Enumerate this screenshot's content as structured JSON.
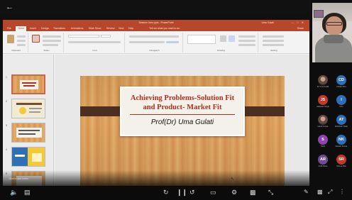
{
  "player": {
    "back_icon": "back-arrow-icon",
    "bottom_icons": [
      "speaker-icon",
      "captions-icon",
      "previous-icon",
      "pause-icon",
      "next-icon",
      "present-icon",
      "settings-icon",
      "fullscreen-icon",
      "pen-icon",
      "expand-icon"
    ]
  },
  "powerpoint": {
    "window_title": "Session Intro.pptx - PowerPoint",
    "user_name": "Uma Gulati",
    "ribbon_tabs": [
      "File",
      "Home",
      "Insert",
      "Design",
      "Transitions",
      "Animations",
      "Slide Show",
      "Review",
      "View",
      "Help"
    ],
    "active_tab": "Home",
    "search_hint": "Tell me what you want to do",
    "share_label": "Share",
    "ribbon_groups": [
      "Clipboard",
      "Slides",
      "Font",
      "Paragraph",
      "Drawing",
      "Editing"
    ],
    "slide_numbers": [
      "1",
      "2",
      "3",
      "4",
      "5"
    ],
    "status_text": "Click to add notes",
    "accent": "#b7472a"
  },
  "slide": {
    "title": "Achieving Problems-Solution Fit and Product- Market Fit",
    "author": "Prof(Dr) Uma Gulati",
    "title_color": "#b12f1d"
  },
  "participants": [
    {
      "initials": "",
      "name": "Dr Uma Gulati",
      "color": "",
      "photo": true
    },
    {
      "initials": "CD",
      "name": "Chetan Dev",
      "color": "#2f6fb5",
      "photo": false
    },
    {
      "initials": "JS",
      "name": "Jaskaran Singh",
      "color": "#c0392b",
      "photo": false
    },
    {
      "initials": "I",
      "name": "Ishu",
      "color": "#2f6fb5",
      "photo": false
    },
    {
      "initials": "",
      "name": "Harsh Gupta",
      "color": "",
      "photo": true
    },
    {
      "initials": "AT",
      "name": "Abhishek Tiwari",
      "color": "#2f6fb5",
      "photo": false
    },
    {
      "initials": "S",
      "name": "Sahil",
      "color": "#8e44ad",
      "photo": false
    },
    {
      "initials": "NK",
      "name": "Naman Kumar",
      "color": "#2f6fb5",
      "photo": false
    },
    {
      "initials": "AR",
      "name": "Ankit Rana",
      "color": "#6d4c8f",
      "photo": false
    },
    {
      "initials": "SR",
      "name": "Shreya Rao",
      "color": "#c0392b",
      "photo": false
    }
  ]
}
